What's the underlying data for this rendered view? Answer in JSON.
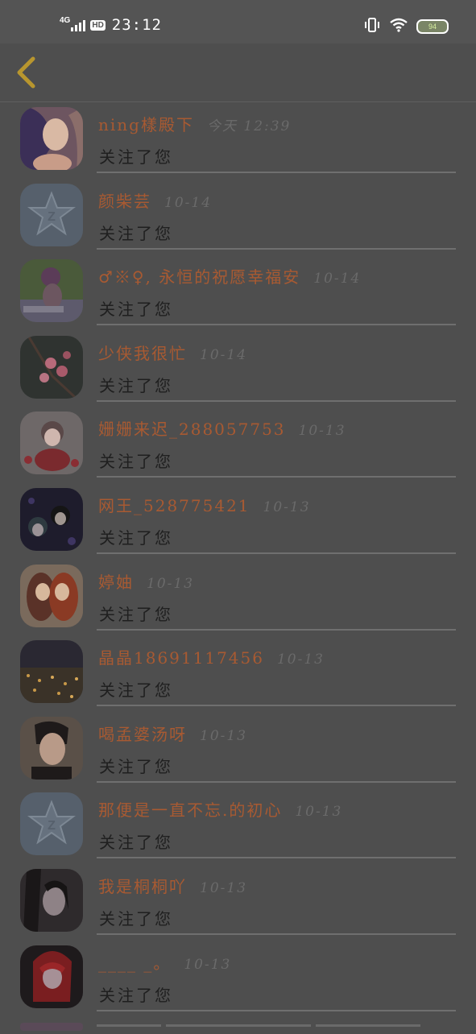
{
  "status_bar": {
    "network": "4G",
    "hd": "HD",
    "time": "23:12",
    "battery": "94"
  },
  "colors": {
    "overlay_bg": "#4e4e4e",
    "name_color": "#a85a32",
    "back_arrow": "#b8962e"
  },
  "items": [
    {
      "name": "ning樣殿下",
      "time": "今天 12:39",
      "message": "关注了您",
      "avatar": "anime-girl-purple-hair"
    },
    {
      "name": "颜柴芸",
      "time": "10-14",
      "message": "关注了您",
      "avatar": "qzone-default"
    },
    {
      "name": "♂※♀, 永恒的祝愿幸福安",
      "time": "10-14",
      "message": "关注了您",
      "avatar": "girl-photo"
    },
    {
      "name": "少侠我很忙",
      "time": "10-14",
      "message": "关注了您",
      "avatar": "plum-blossom"
    },
    {
      "name": "姗姗来迟_288057753",
      "time": "10-13",
      "message": "关注了您",
      "avatar": "anime-chibi"
    },
    {
      "name": "网王_528775421",
      "time": "10-13",
      "message": "关注了您",
      "avatar": "anime-couple-dark"
    },
    {
      "name": "婷妯",
      "time": "10-13",
      "message": "关注了您",
      "avatar": "anime-twins"
    },
    {
      "name": "晶晶18691117456",
      "time": "10-13",
      "message": "关注了您",
      "avatar": "city-night"
    },
    {
      "name": "喝孟婆汤呀",
      "time": "10-13",
      "message": "关注了您",
      "avatar": "man-portrait"
    },
    {
      "name": "那便是一直不忘.的初心",
      "time": "10-13",
      "message": "关注了您",
      "avatar": "qzone-default"
    },
    {
      "name": "我是桐桐吖",
      "time": "10-13",
      "message": "关注了您",
      "avatar": "dark-girl"
    },
    {
      "name": "____ _。",
      "time": "10-13",
      "message": "关注了您",
      "avatar": "red-hair-anime"
    }
  ]
}
